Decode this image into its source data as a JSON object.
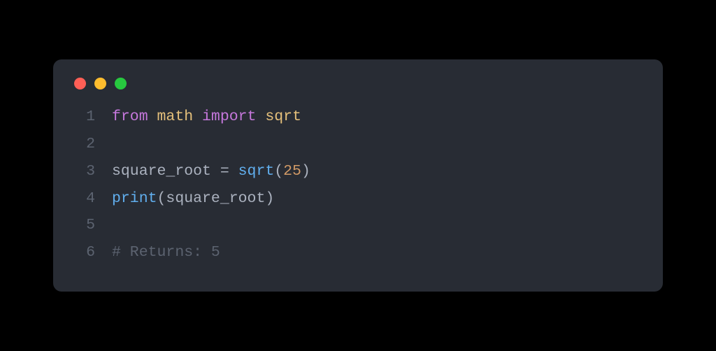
{
  "window": {
    "traffic_light_colors": [
      "#ff5f56",
      "#ffbd2e",
      "#27c93f"
    ]
  },
  "code": {
    "language": "python",
    "lines": [
      {
        "n": "1",
        "tokens": [
          {
            "cls": "tok-keyword",
            "t": "from"
          },
          {
            "cls": "tok-text",
            "t": " "
          },
          {
            "cls": "tok-module",
            "t": "math"
          },
          {
            "cls": "tok-text",
            "t": " "
          },
          {
            "cls": "tok-keyword",
            "t": "import"
          },
          {
            "cls": "tok-text",
            "t": " "
          },
          {
            "cls": "tok-module",
            "t": "sqrt"
          }
        ]
      },
      {
        "n": "2",
        "tokens": []
      },
      {
        "n": "3",
        "tokens": [
          {
            "cls": "tok-text",
            "t": "square_root "
          },
          {
            "cls": "tok-punct",
            "t": "= "
          },
          {
            "cls": "tok-func",
            "t": "sqrt"
          },
          {
            "cls": "tok-punct",
            "t": "("
          },
          {
            "cls": "tok-number",
            "t": "25"
          },
          {
            "cls": "tok-punct",
            "t": ")"
          }
        ]
      },
      {
        "n": "4",
        "tokens": [
          {
            "cls": "tok-func",
            "t": "print"
          },
          {
            "cls": "tok-punct",
            "t": "("
          },
          {
            "cls": "tok-text",
            "t": "square_root"
          },
          {
            "cls": "tok-punct",
            "t": ")"
          }
        ]
      },
      {
        "n": "5",
        "tokens": []
      },
      {
        "n": "6",
        "tokens": [
          {
            "cls": "tok-comment",
            "t": "# Returns: 5"
          }
        ]
      }
    ]
  }
}
